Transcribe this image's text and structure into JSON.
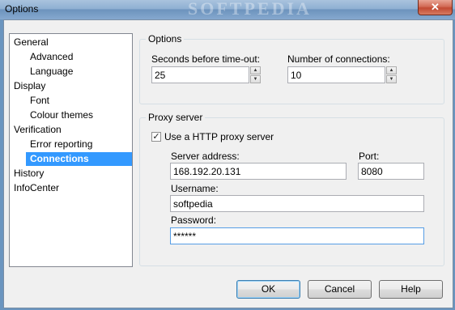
{
  "window": {
    "title": "Options",
    "watermark": "SOFTPEDIA",
    "close_label": "✕"
  },
  "tree": [
    {
      "label": "General",
      "level": 0,
      "selected": false
    },
    {
      "label": "Advanced",
      "level": 1,
      "selected": false
    },
    {
      "label": "Language",
      "level": 1,
      "selected": false
    },
    {
      "label": "Display",
      "level": 0,
      "selected": false
    },
    {
      "label": "Font",
      "level": 1,
      "selected": false
    },
    {
      "label": "Colour themes",
      "level": 1,
      "selected": false
    },
    {
      "label": "Verification",
      "level": 0,
      "selected": false
    },
    {
      "label": "Error reporting",
      "level": 1,
      "selected": false
    },
    {
      "label": "Connections",
      "level": 1,
      "selected": true
    },
    {
      "label": "History",
      "level": 0,
      "selected": false
    },
    {
      "label": "InfoCenter",
      "level": 0,
      "selected": false
    }
  ],
  "options_group": {
    "title": "Options",
    "timeout_label": "Seconds before time-out:",
    "timeout_value": "25",
    "connections_label": "Number of connections:",
    "connections_value": "10"
  },
  "proxy_group": {
    "title": "Proxy server",
    "use_proxy_label": "Use a HTTP proxy server",
    "use_proxy_checked": true,
    "server_label": "Server address:",
    "server_value": "168.192.20.131",
    "port_label": "Port:",
    "port_value": "8080",
    "username_label": "Username:",
    "username_value": "softpedia",
    "password_label": "Password:",
    "password_value": "******"
  },
  "buttons": {
    "ok": "OK",
    "cancel": "Cancel",
    "help": "Help"
  }
}
